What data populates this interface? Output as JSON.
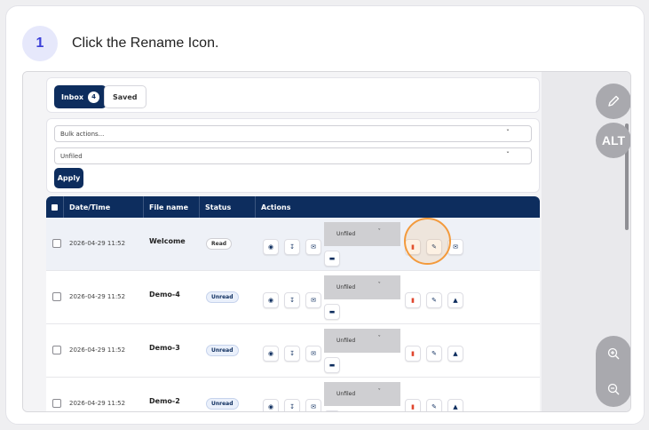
{
  "step": {
    "number": "1",
    "instruction": "Click the Rename Icon."
  },
  "tabs": {
    "inbox_label": "Inbox",
    "inbox_count": "4",
    "saved_label": "Saved"
  },
  "filters": {
    "bulk_actions": "Bulk actions...",
    "folder": "Unfiled",
    "apply_label": "Apply"
  },
  "table": {
    "headers": [
      "Date/Time",
      "File name",
      "Status",
      "Actions"
    ],
    "folder_option": "Unfiled",
    "rows": [
      {
        "date": "2026-04-29 11:52",
        "name": "Welcome",
        "status": "Read"
      },
      {
        "date": "2026-04-29 11:52",
        "name": "Demo-4",
        "status": "Unread"
      },
      {
        "date": "2026-04-29 11:52",
        "name": "Demo-3",
        "status": "Unread"
      },
      {
        "date": "2026-04-29 11:52",
        "name": "Demo-2",
        "status": "Unread"
      }
    ]
  },
  "side_tools": {
    "alt_label": "ALT"
  },
  "colors": {
    "navy": "#0d2d5e",
    "accent_ring": "#f39a3c",
    "step_badge": "#3b3fd8",
    "delete_red": "#e0452d"
  },
  "icons": [
    "pencil-icon",
    "zoom-in-icon",
    "zoom-out-icon",
    "eye-icon",
    "download-icon",
    "mail-icon",
    "trash-icon",
    "rename-icon",
    "move-icon",
    "chevron-down-icon"
  ]
}
